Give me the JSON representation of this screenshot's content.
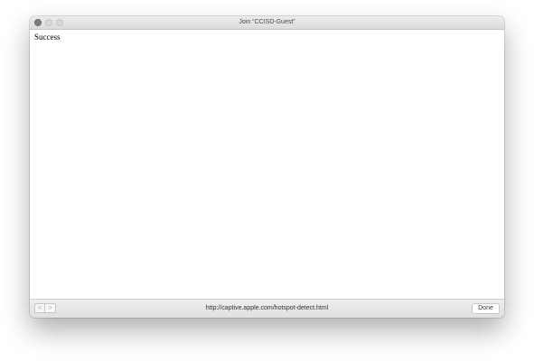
{
  "window": {
    "title": "Join “CCISD-Guest”"
  },
  "content": {
    "text": "Success"
  },
  "bottombar": {
    "back_glyph": "<",
    "forward_glyph": ">",
    "url": "http://captive.apple.com/hotspot-detect.html",
    "done_label": "Done"
  },
  "icons": {
    "close": "close-traffic-light",
    "minimize": "minimize-traffic-light",
    "zoom": "zoom-traffic-light",
    "back": "chevron-left-icon",
    "forward": "chevron-right-icon"
  }
}
